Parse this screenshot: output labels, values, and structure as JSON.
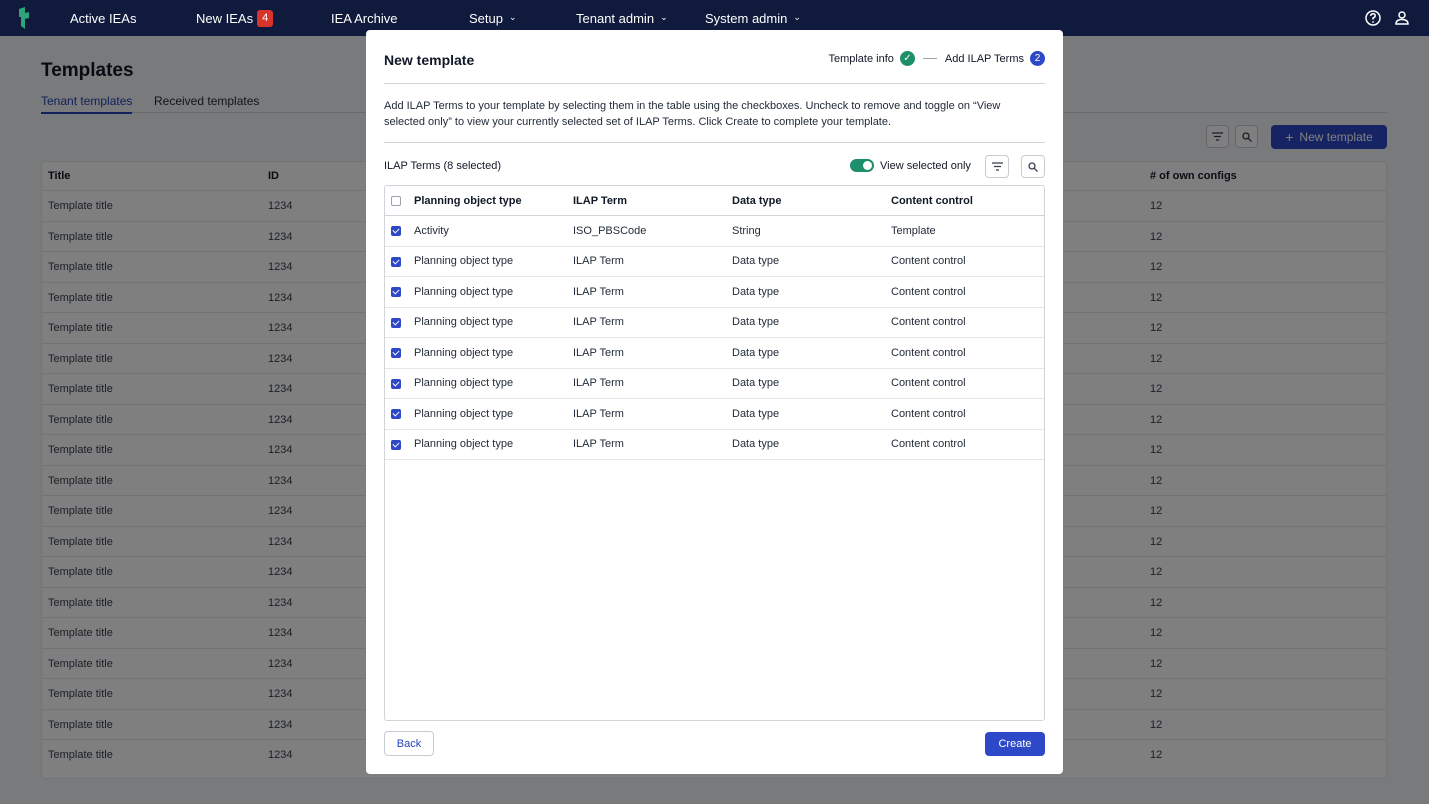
{
  "nav": {
    "items": [
      {
        "label": "Active IEAs"
      },
      {
        "label": "New IEAs",
        "badge": "4"
      },
      {
        "label": "IEA Archive"
      },
      {
        "label": "Setup"
      },
      {
        "label": "Tenant admin"
      },
      {
        "label": "System admin"
      }
    ],
    "icons": [
      "help-icon",
      "user-icon"
    ]
  },
  "page": {
    "title": "Templates",
    "tabs": [
      "Tenant templates",
      "Received templates"
    ],
    "new_template_label": "New template",
    "table": {
      "headers": [
        "Title",
        "ID",
        "# of own configs"
      ],
      "rows": [
        [
          "Template title",
          "1234",
          "12"
        ],
        [
          "Template title",
          "1234",
          "12"
        ],
        [
          "Template title",
          "1234",
          "12"
        ],
        [
          "Template title",
          "1234",
          "12"
        ],
        [
          "Template title",
          "1234",
          "12"
        ],
        [
          "Template title",
          "1234",
          "12"
        ],
        [
          "Template title",
          "1234",
          "12"
        ],
        [
          "Template title",
          "1234",
          "12"
        ],
        [
          "Template title",
          "1234",
          "12"
        ],
        [
          "Template title",
          "1234",
          "12"
        ],
        [
          "Template title",
          "1234",
          "12"
        ],
        [
          "Template title",
          "1234",
          "12"
        ],
        [
          "Template title",
          "1234",
          "12"
        ],
        [
          "Template title",
          "1234",
          "12"
        ],
        [
          "Template title",
          "1234",
          "12"
        ],
        [
          "Template title",
          "1234",
          "12"
        ],
        [
          "Template title",
          "1234",
          "12"
        ],
        [
          "Template title",
          "1234",
          "12"
        ],
        [
          "Template title",
          "1234",
          "12"
        ]
      ]
    }
  },
  "modal": {
    "title": "New template",
    "steps": [
      {
        "label": "Template info",
        "status": "done"
      },
      {
        "label": "Add ILAP Terms",
        "number": "2"
      }
    ],
    "description": "Add ILAP Terms to your template by selecting them in the table using the checkboxes. Uncheck to remove and toggle on “View selected only” to view your currently selected set of ILAP Terms. Click Create to complete your template.",
    "terms_label": "ILAP Terms (8 selected)",
    "toggle_label": "View selected only",
    "table": {
      "headers": [
        "Planning object type",
        "ILAP Term",
        "Data type",
        "Content control"
      ],
      "rows": [
        [
          "Activity",
          "ISO_PBSCode",
          "String",
          "Template"
        ],
        [
          "Planning object type",
          "ILAP Term",
          "Data type",
          "Content control"
        ],
        [
          "Planning object type",
          "ILAP Term",
          "Data type",
          "Content control"
        ],
        [
          "Planning object type",
          "ILAP Term",
          "Data type",
          "Content control"
        ],
        [
          "Planning object type",
          "ILAP Term",
          "Data type",
          "Content control"
        ],
        [
          "Planning object type",
          "ILAP Term",
          "Data type",
          "Content control"
        ],
        [
          "Planning object type",
          "ILAP Term",
          "Data type",
          "Content control"
        ],
        [
          "Planning object type",
          "ILAP Term",
          "Data type",
          "Content control"
        ]
      ]
    },
    "back_label": "Back",
    "create_label": "Create"
  },
  "colors": {
    "nav_bg": "#0f1a3c",
    "primary": "#2e49c8",
    "success": "#1f8f6b",
    "badge": "#d9342b"
  }
}
